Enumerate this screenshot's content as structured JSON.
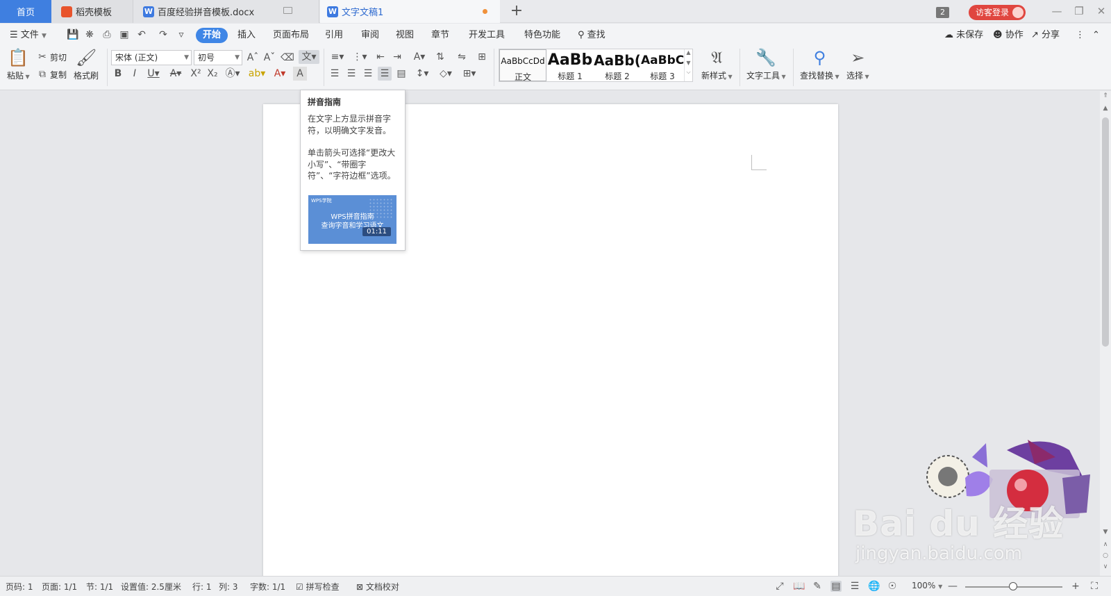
{
  "tabs": {
    "home": "首页",
    "tab1": "稻壳模板",
    "tab2": "百度经验拼音模板.docx",
    "tab3": "文字文稿1",
    "add": "+"
  },
  "titlebar": {
    "window_count": "2",
    "guest_login": "访客登录"
  },
  "menu": {
    "file": "文件",
    "items": [
      "开始",
      "插入",
      "页面布局",
      "引用",
      "审阅",
      "视图",
      "章节",
      "开发工具",
      "特色功能"
    ],
    "find": "查找",
    "unsaved": "未保存",
    "collab": "协作",
    "share": "分享"
  },
  "ribbon": {
    "paste": "粘贴",
    "cut": "剪切",
    "copy": "复制",
    "format_painter": "格式刷",
    "font_name": "宋体 (正文)",
    "font_size": "初号",
    "styles": [
      {
        "preview": "AaBbCcDd",
        "label": "正文"
      },
      {
        "preview": "AaBb",
        "label": "标题 1"
      },
      {
        "preview": "AaBb(",
        "label": "标题 2"
      },
      {
        "preview": "AaBbC",
        "label": "标题 3"
      }
    ],
    "new_style": "新样式",
    "text_tools": "文字工具",
    "find_replace": "查找替换",
    "select": "选择"
  },
  "tooltip": {
    "title": "拼音指南",
    "desc": "在文字上方显示拼音字符，以明确文字发音。",
    "desc2": "单击箭头可选择“更改大小写”、“带圈字符”、“字符边框”选项。",
    "video_logo": "WPS学院",
    "video_title1": "WPS拼音指南",
    "video_title2": "查询字音和学习语文",
    "video_duration": "01:11"
  },
  "watermark": {
    "brand": "Bai du 经验",
    "url": "jingyan.baidu.com"
  },
  "status": {
    "page": "页码: 1",
    "pages": "页面: 1/1",
    "section": "节: 1/1",
    "setting": "设置值: 2.5厘米",
    "row": "行: 1",
    "col": "列: 3",
    "words": "字数: 1/1",
    "spell": "拼写检查",
    "proof": "文档校对",
    "zoom": "100%"
  },
  "colors": {
    "accent": "#3f86e6",
    "login": "#e0463f",
    "modified_dot": "#f0913b"
  }
}
